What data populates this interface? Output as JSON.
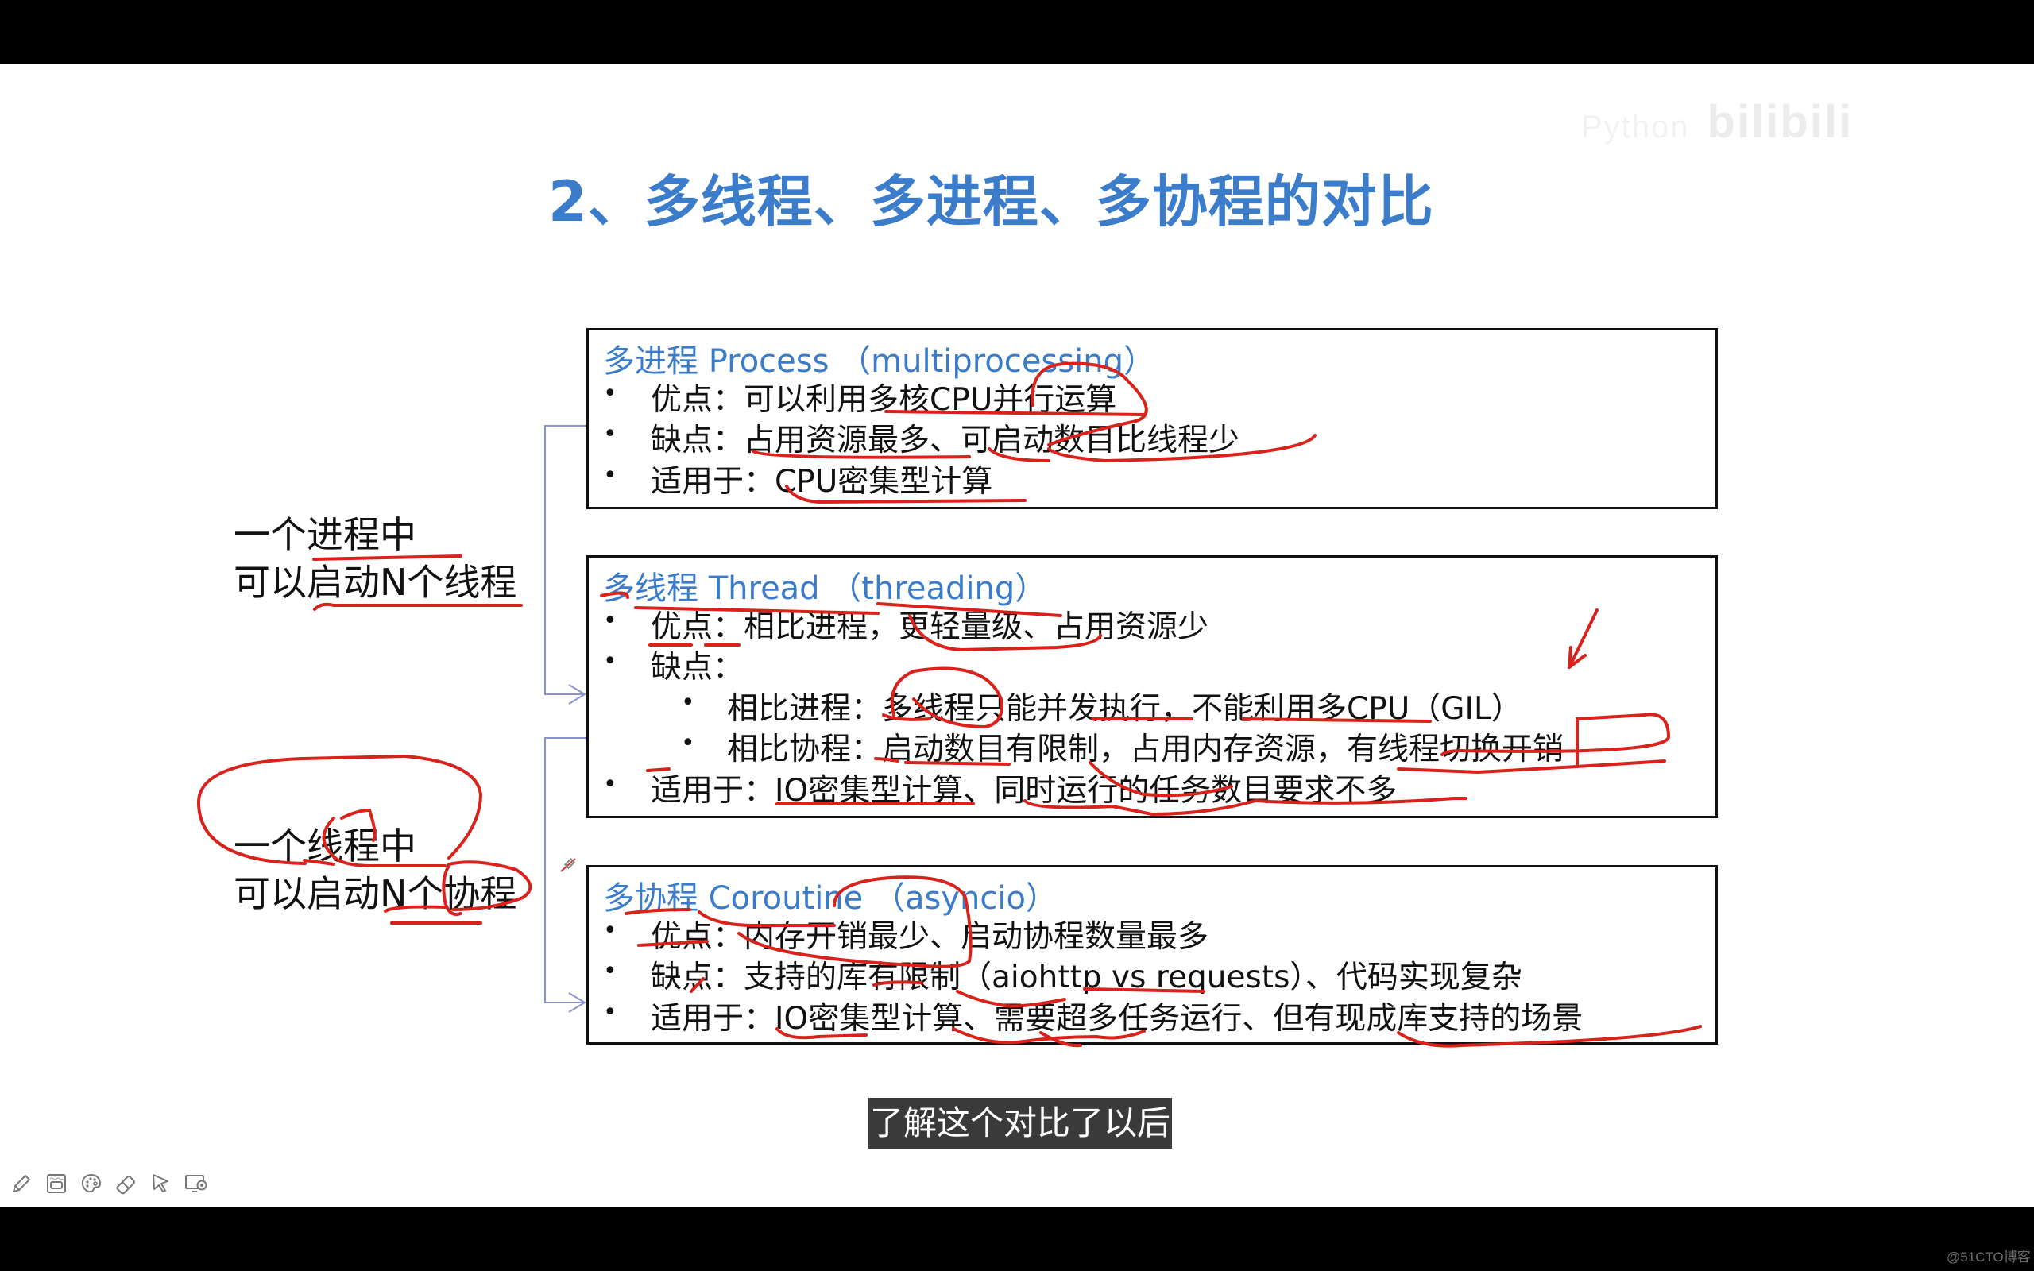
{
  "watermarks": {
    "bilibili_sub": "Python",
    "bilibili": "bilibili",
    "site": "@51CTO博客"
  },
  "slide": {
    "title": "2、多线程、多进程、多协程的对比",
    "left_labels": [
      {
        "line1": "一个进程中",
        "line2": "可以启动N个线程"
      },
      {
        "line1": "一个线程中",
        "line2": "可以启动N个协程"
      }
    ],
    "boxes": [
      {
        "heading": "多进程 Process （multiprocessing）",
        "lines": [
          {
            "level": 1,
            "text": "优点：可以利用多核CPU并行运算"
          },
          {
            "level": 1,
            "text": "缺点：占用资源最多、可启动数目比线程少"
          },
          {
            "level": 1,
            "text": "适用于：CPU密集型计算"
          }
        ]
      },
      {
        "heading": "多线程 Thread （threading）",
        "lines": [
          {
            "level": 1,
            "text": "优点：相比进程，更轻量级、占用资源少"
          },
          {
            "level": 1,
            "text": "缺点："
          },
          {
            "level": 2,
            "text": "相比进程：多线程只能并发执行，不能利用多CPU（GIL）"
          },
          {
            "level": 2,
            "text": "相比协程：启动数目有限制，占用内存资源，有线程切换开销"
          },
          {
            "level": 1,
            "text": "适用于：IO密集型计算、同时运行的任务数目要求不多"
          }
        ]
      },
      {
        "heading": "多协程 Coroutine （asyncio）",
        "lines": [
          {
            "level": 1,
            "text": "优点：内存开销最少、启动协程数量最多"
          },
          {
            "level": 1,
            "text": "缺点：支持的库有限制（aiohttp vs requests）、代码实现复杂"
          },
          {
            "level": 1,
            "text": "适用于：IO密集型计算、需要超多任务运行、但有现成库支持的场景"
          }
        ]
      }
    ],
    "bullet_glyph": "•"
  },
  "subtitle": "了解这个对比了以后",
  "toolbar": {
    "tools": [
      {
        "name": "pen-tool",
        "icon": "pencil-icon"
      },
      {
        "name": "whiteboard-tool",
        "icon": "whiteboard-icon"
      },
      {
        "name": "color-tool",
        "icon": "palette-icon"
      },
      {
        "name": "eraser-tool",
        "icon": "eraser-icon"
      },
      {
        "name": "pointer-tool",
        "icon": "cursor-arrow-icon"
      },
      {
        "name": "screen-record-tool",
        "icon": "monitor-record-icon"
      }
    ]
  },
  "colors": {
    "title": "#3b7ccb",
    "heading": "#3a7cc9",
    "annotation": "#d9221c",
    "connector": "#8b93cf",
    "subtitle_bg": "#3a3a3a"
  }
}
